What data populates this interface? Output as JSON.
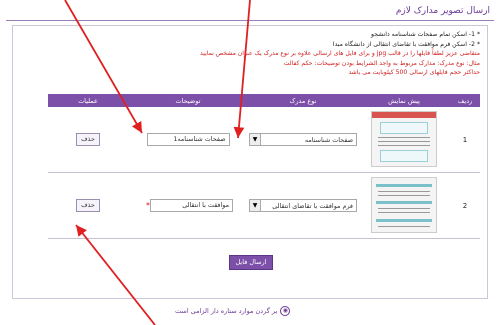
{
  "page": {
    "title": "ارسال تصویر مدارک لازم"
  },
  "notes": [
    {
      "text": "* 1- اسکن تمام صفحات شناسنامه دانشجو",
      "color": "black"
    },
    {
      "text": "* 2- اسکن فرم موافقت با تقاضای انتقالی از دانشگاه مبدا",
      "color": "black"
    },
    {
      "text": "متقاضی عزیز لطفاً فایلها را در قالب jpg و برای فایل های ارسالی علاوه بر نوع مدرک یک عنوان مشخص نمایید",
      "color": "red"
    },
    {
      "text": "مثال: نوع مدرک: مدارک مربوط به واجد الشرایط بودن    توضیحات: حکم کفالت",
      "color": "red"
    },
    {
      "text": "حداکثر حجم فایلهای ارسالی 500 کیلوبایت می باشد",
      "color": "red"
    }
  ],
  "table": {
    "headers": {
      "idx": "ردیف",
      "preview": "پیش نمایش",
      "type": "نوع مدرک",
      "desc": "توضیحات",
      "ops": "عملیات"
    },
    "rows": [
      {
        "idx": "1",
        "type": "صفحات شناسنامه",
        "desc": "صفحات شناسنامه1",
        "delete": "حذف"
      },
      {
        "idx": "2",
        "type": "فرم موافقت با تقاضای انتقالی",
        "desc": "موافقت با انتقالی",
        "delete": "حذف"
      }
    ]
  },
  "send_button": "ارسال فایل",
  "back_link": "بر گردن موارد ستاره دار الزامی است",
  "annotation_arrow_color": "#e02020",
  "accent_color": "#7c4fa8"
}
